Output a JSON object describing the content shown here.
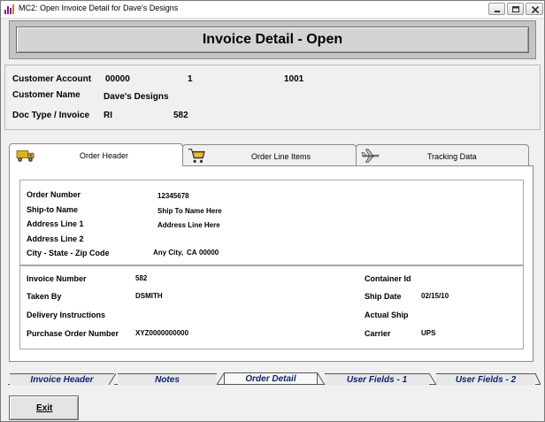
{
  "window": {
    "title": "MC2: Open Invoice Detail for Dave's Designs"
  },
  "header": {
    "title": "Invoice Detail - Open"
  },
  "customer": {
    "account_label": "Customer Account",
    "account_value_1": "00000",
    "account_value_2": "1",
    "account_value_3": "1001",
    "name_label": "Customer Name",
    "name_value": "Dave's Designs",
    "doc_label": "Doc Type / Invoice",
    "doc_type": "RI",
    "invoice_no": "582"
  },
  "tabs": [
    {
      "label": "Order Header",
      "icon": "truck-icon"
    },
    {
      "label": "Order Line Items",
      "icon": "cart-icon"
    },
    {
      "label": "Tracking Data",
      "icon": "airplane-icon"
    }
  ],
  "order_header": {
    "order_number_label": "Order Number",
    "order_number": "12345678",
    "ship_to_label": "Ship-to Name",
    "ship_to": "Ship To Name Here",
    "addr1_label": "Address Line 1",
    "addr1": "Address Line Here",
    "addr2_label": "Address Line 2",
    "city_label": "City - State - Zip Code",
    "city": "Any City,",
    "state": "CA",
    "zip": "00000",
    "invoice_number_label": "Invoice Number",
    "invoice_number": "582",
    "taken_by_label": "Taken By",
    "taken_by": "DSMITH",
    "delivery_label": "Delivery Instructions",
    "po_label": "Purchase Order Number",
    "po_number": "XYZ0000000000",
    "container_label": "Container Id",
    "ship_date_label": "Ship Date",
    "ship_date": "02/15/10",
    "actual_ship_label": "Actual Ship",
    "carrier_label": "Carrier",
    "carrier": "UPS"
  },
  "bottom_tabs": [
    "Invoice Header",
    "Notes",
    "Order Detail",
    "User Fields - 1",
    "User Fields - 2"
  ],
  "exit_label": "Exit",
  "colors": {
    "bottom_tab_text": "#0a246a",
    "header_band": "#c4c4c4"
  }
}
